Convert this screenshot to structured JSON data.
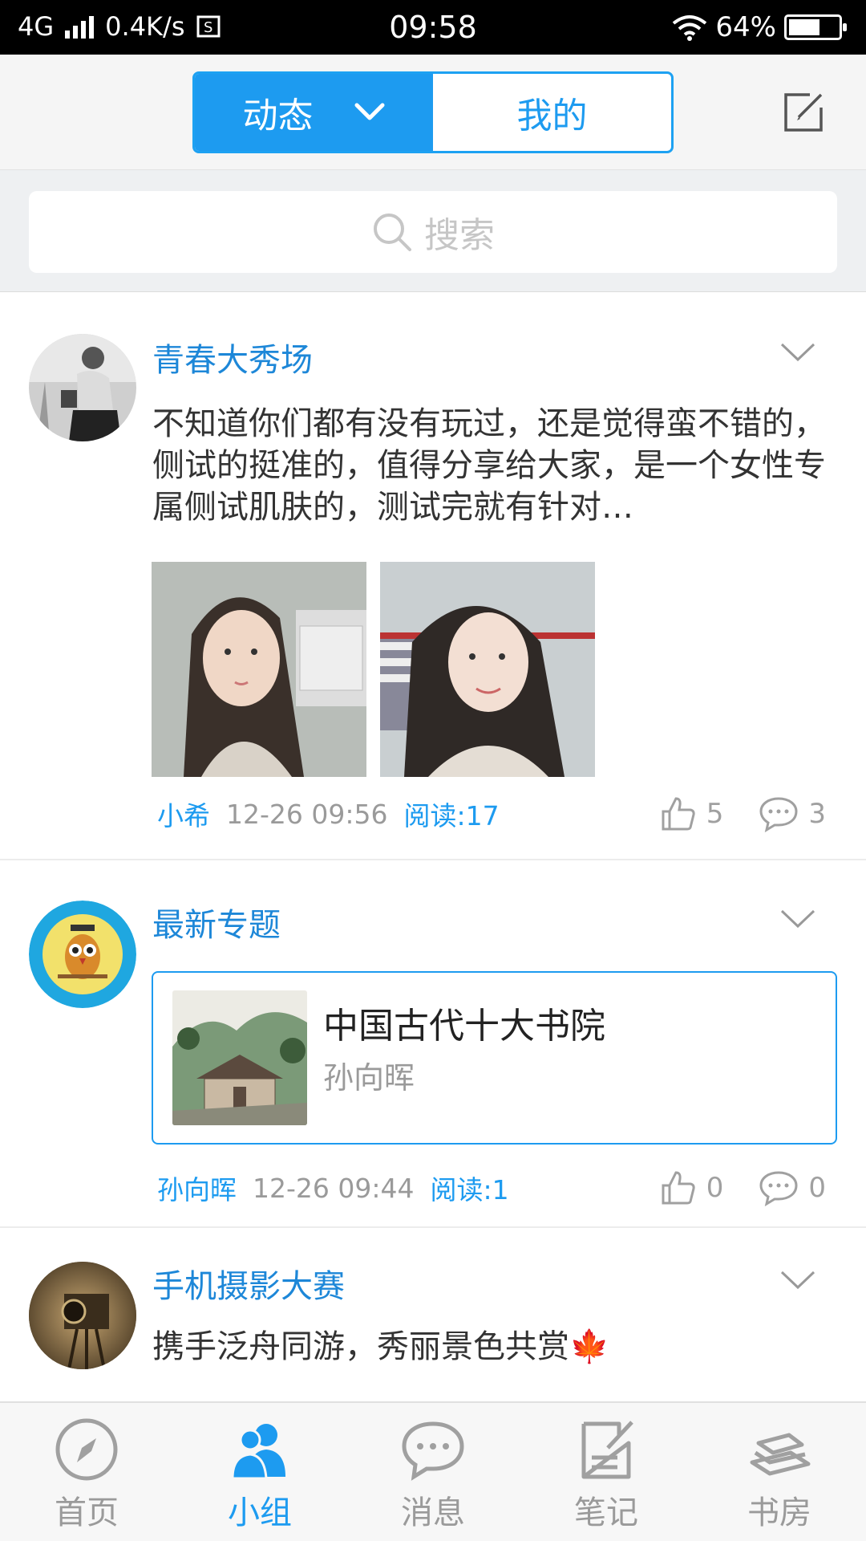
{
  "status_bar": {
    "network": "4G",
    "speed": "0.4K/s",
    "time": "09:58",
    "battery": "64%",
    "battery_level": 0.64
  },
  "header": {
    "segment_active": "动态",
    "segment_inactive": "我的"
  },
  "search": {
    "placeholder": "搜索"
  },
  "posts": [
    {
      "group": "青春大秀场",
      "text": "不知道你们都有没有玩过，还是觉得蛮不错的，侧试的挺准的，值得分享给大家，是一个女性专属侧试肌肤的，测试完就有针对…",
      "author": "小希",
      "time": "12-26 09:56",
      "reads": "阅读:17",
      "likes": "5",
      "comments": "3"
    },
    {
      "group": "最新专题",
      "topic_title": "中国古代十大书院",
      "topic_author": "孙向晖",
      "author": "孙向晖",
      "time": "12-26 09:44",
      "reads": "阅读:1",
      "likes": "0",
      "comments": "0"
    },
    {
      "group": "手机摄影大赛",
      "text": "携手泛舟同游，秀丽景色共赏🍁"
    }
  ],
  "tabs": [
    {
      "label": "首页",
      "icon": "compass-icon"
    },
    {
      "label": "小组",
      "icon": "group-icon"
    },
    {
      "label": "消息",
      "icon": "chat-bubble-icon"
    },
    {
      "label": "笔记",
      "icon": "note-icon"
    },
    {
      "label": "书房",
      "icon": "bookshelf-icon"
    }
  ],
  "colors": {
    "accent": "#1d9bf0",
    "link": "#1d87d8",
    "muted": "#9a9a9a"
  }
}
